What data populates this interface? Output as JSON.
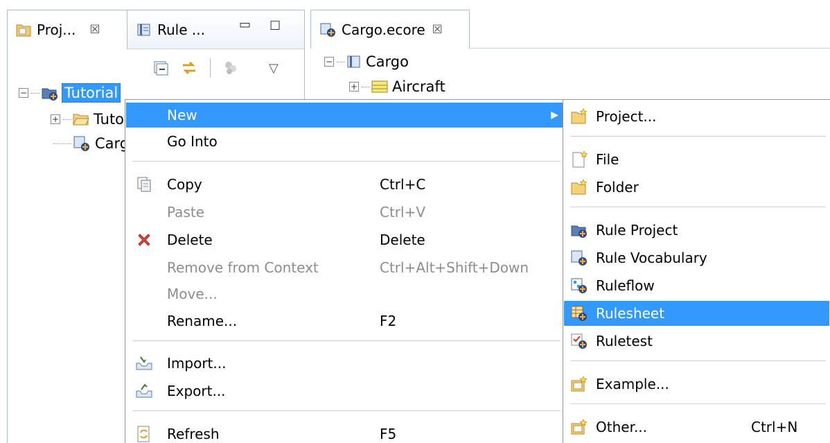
{
  "left_view": {
    "tabs": [
      {
        "label": "Proj...",
        "close": "☒",
        "icon": "project-explorer-icon"
      },
      {
        "label": "Rule ...",
        "icon": "rule-vocabulary-icon"
      }
    ],
    "view_controls": {
      "minimize": "▭",
      "maximize": "☐"
    },
    "toolbar": [
      "collapse-all-icon",
      "link-with-editor-icon",
      "filter-icon",
      "view-menu-icon"
    ],
    "view_menu_glyph": "▽",
    "tree": {
      "root_label": "Tutorial",
      "root_toggle": "−",
      "child_folder_label": "Tuto",
      "child_folder_toggle": "+",
      "child_file_label": "Carg"
    }
  },
  "right_view": {
    "tab": {
      "label": "Cargo.ecore",
      "close": "☒"
    },
    "tree": {
      "root_label": "Cargo",
      "root_toggle": "−",
      "child_label": "Aircraft",
      "child_toggle": "+"
    }
  },
  "context_menu": {
    "items": [
      {
        "label": "New",
        "highlighted": true,
        "has_submenu": true,
        "arrow": "▶"
      },
      {
        "label": "Go Into"
      },
      {
        "label": "Copy",
        "shortcut": "Ctrl+C",
        "icon": "copy-icon"
      },
      {
        "label": "Paste",
        "shortcut": "Ctrl+V",
        "disabled": true
      },
      {
        "label": "Delete",
        "shortcut": "Delete",
        "icon": "delete-icon"
      },
      {
        "label": "Remove from Context",
        "shortcut": "Ctrl+Alt+Shift+Down",
        "disabled": true
      },
      {
        "label": "Move...",
        "disabled": true
      },
      {
        "label": "Rename...",
        "shortcut": "F2"
      },
      {
        "label": "Import...",
        "icon": "import-icon"
      },
      {
        "label": "Export...",
        "icon": "export-icon"
      },
      {
        "label": "Refresh",
        "shortcut": "F5",
        "icon": "refresh-icon"
      }
    ]
  },
  "submenu": {
    "items": [
      {
        "label": "Project...",
        "icon": "new-project-icon"
      },
      {
        "label": "File",
        "icon": "new-file-icon"
      },
      {
        "label": "Folder",
        "icon": "new-folder-icon"
      },
      {
        "label": "Rule Project",
        "icon": "rule-project-icon"
      },
      {
        "label": "Rule Vocabulary",
        "icon": "rule-vocabulary-icon"
      },
      {
        "label": "Ruleflow",
        "icon": "ruleflow-icon"
      },
      {
        "label": "Rulesheet",
        "icon": "rulesheet-icon",
        "highlighted": true
      },
      {
        "label": "Ruletest",
        "icon": "ruletest-icon"
      },
      {
        "label": "Example...",
        "icon": "new-example-icon"
      },
      {
        "label": "Other...",
        "shortcut": "Ctrl+N",
        "icon": "new-other-icon"
      }
    ]
  },
  "colors": {
    "selection": "#3399ff",
    "disabled_text": "#8d8d8d",
    "view_border": "#a9bdd6"
  }
}
